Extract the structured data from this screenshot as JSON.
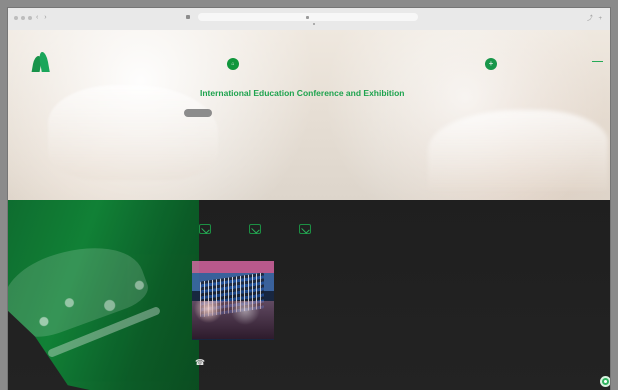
{
  "hero": {
    "title": "International Education Conference and Exhibition"
  }
}
